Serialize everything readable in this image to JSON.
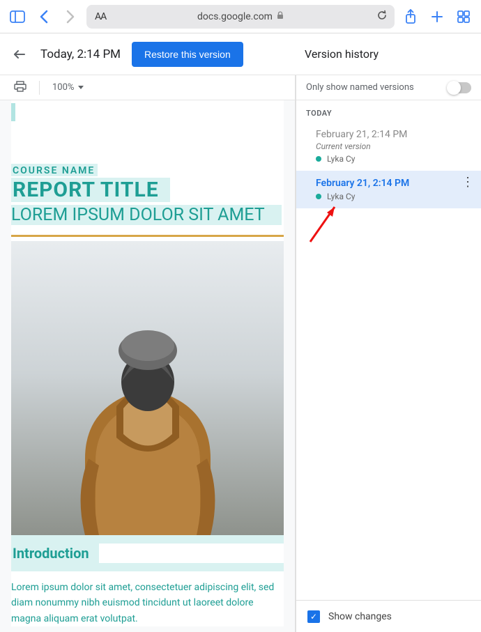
{
  "browser": {
    "url": "docs.google.com",
    "text_size_label": "AA"
  },
  "toolbar": {
    "today_label": "Today, 2:14 PM",
    "restore_label": "Restore this version",
    "panel_title": "Version history"
  },
  "subtoolbar": {
    "zoom": "100%"
  },
  "document": {
    "course_label": "COURSE NAME",
    "title": "REPORT TITLE",
    "subtitle": "LOREM IPSUM DOLOR SIT AMET",
    "intro_heading": "Introduction",
    "body": "Lorem ipsum dolor sit amet, consectetuer adipiscing elit, sed diam nonummy nibh euismod tincidunt ut laoreet dolore magna aliquam erat volutpat."
  },
  "version_panel": {
    "only_named_label": "Only show named versions",
    "section_today": "TODAY",
    "items": [
      {
        "date": "February 21, 2:14 PM",
        "sub": "Current version",
        "user": "Lyka Cy"
      },
      {
        "date": "February 21, 2:14 PM",
        "user": "Lyka Cy"
      }
    ],
    "show_changes_label": "Show changes"
  },
  "colors": {
    "accent_teal": "#1e9e94",
    "teal_tint": "#d9f2f1",
    "gold": "#d7a648",
    "google_blue": "#1a73e8"
  }
}
